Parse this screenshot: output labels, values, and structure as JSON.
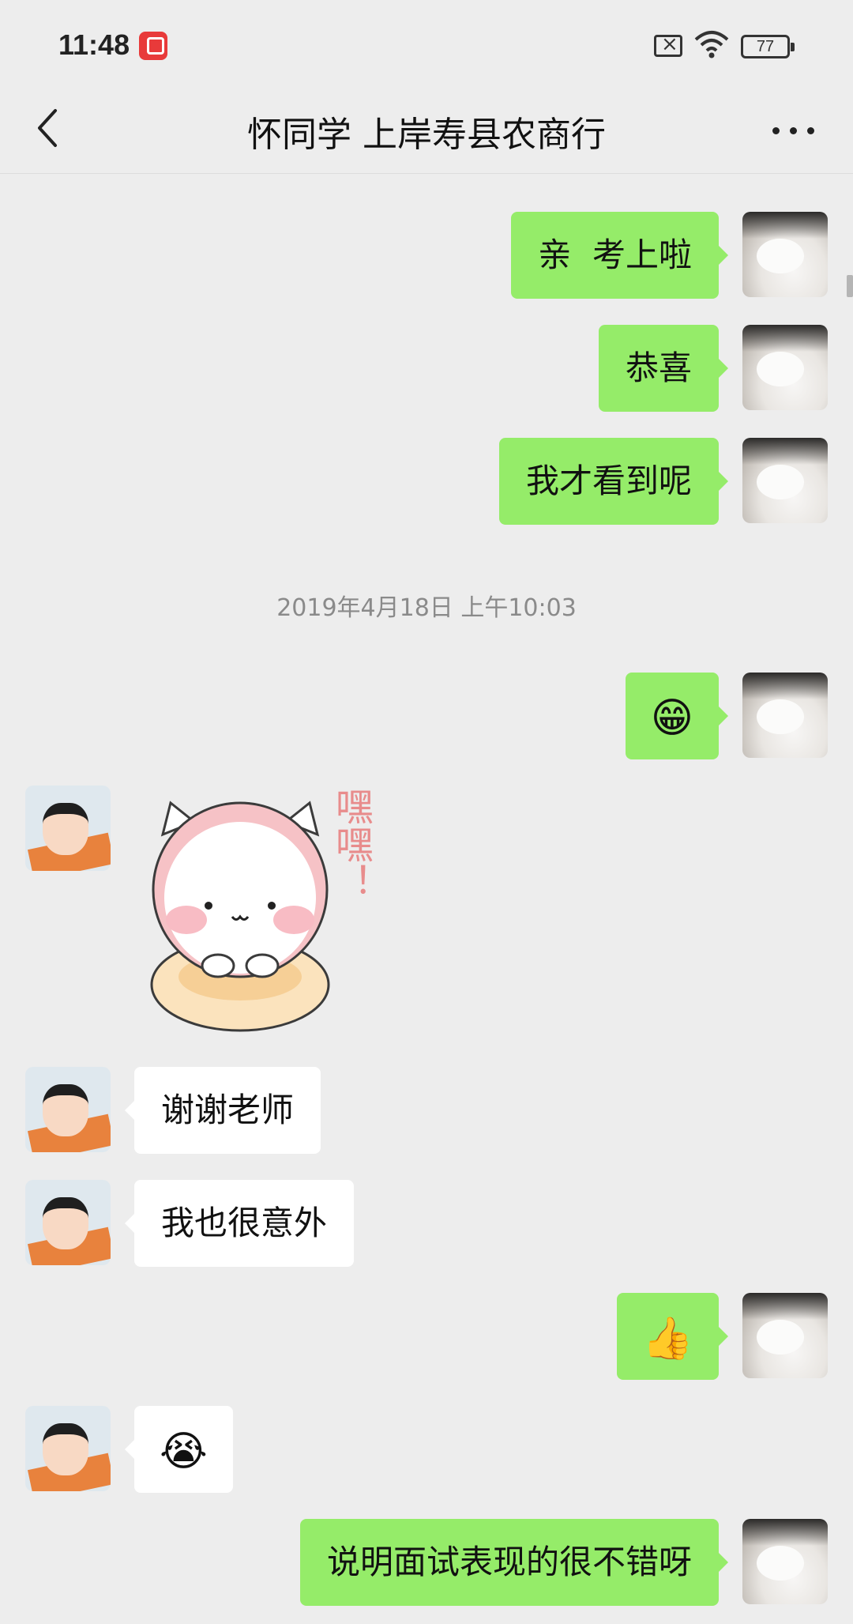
{
  "status_bar": {
    "time": "11:48",
    "battery": "77"
  },
  "nav": {
    "title": "怀同学 上岸寿县农商行"
  },
  "timestamp": "2019年4月18日 上午10:03",
  "messages": [
    {
      "side": "me",
      "text": "亲  考上啦"
    },
    {
      "side": "me",
      "text": "恭喜"
    },
    {
      "side": "me",
      "text": "我才看到呢"
    },
    {
      "side": "me",
      "emoji": "😁"
    },
    {
      "side": "them",
      "sticker_text": "嘿嘿！"
    },
    {
      "side": "them",
      "text": "谢谢老师"
    },
    {
      "side": "them",
      "text": "我也很意外"
    },
    {
      "side": "me",
      "emoji": "👍"
    },
    {
      "side": "them",
      "emoji": "😭"
    },
    {
      "side": "me",
      "text": "说明面试表现的很不错呀"
    }
  ]
}
